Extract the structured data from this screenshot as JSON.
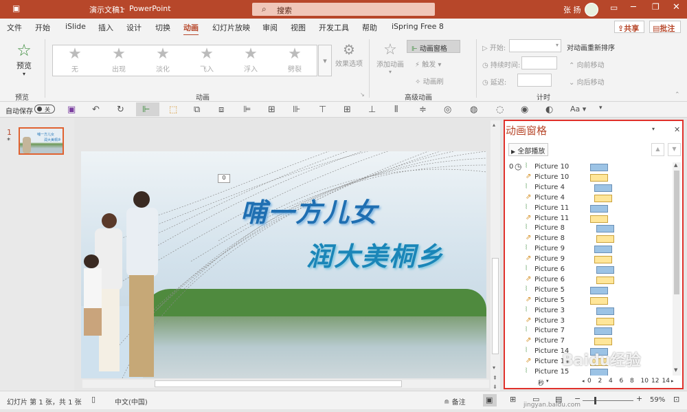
{
  "title": {
    "doc": "演示文稿1",
    "sep": "-",
    "app": "PowerPoint",
    "user": "张 扬"
  },
  "search": {
    "placeholder": "搜索"
  },
  "tabs": [
    "文件",
    "开始",
    "iSlide",
    "插入",
    "设计",
    "切换",
    "动画",
    "幻灯片放映",
    "审阅",
    "视图",
    "开发工具",
    "帮助",
    "iSpring Free 8"
  ],
  "active_tab": "动画",
  "share": {
    "share": "共享",
    "comment": "批注"
  },
  "ribbon": {
    "preview": "预览",
    "preview_group": "预览",
    "gallery": [
      "无",
      "出现",
      "淡化",
      "飞入",
      "浮入",
      "劈裂"
    ],
    "effect_options": "效果选项",
    "animation_group": "动画",
    "add_animation": "添加动画",
    "anim_pane": "动画窗格",
    "trigger": "触发",
    "anim_brush": "动画刷",
    "advanced_group": "高级动画",
    "start": "开始:",
    "duration": "持续时间:",
    "delay": "延迟:",
    "reorder": "对动画重新排序",
    "move_earlier": "向前移动",
    "move_later": "向后移动",
    "timing_group": "计时"
  },
  "qat": {
    "autosave": "自动保存",
    "toggle": "关"
  },
  "thumb": {
    "number": "1",
    "star": "*"
  },
  "slide": {
    "tag": "0",
    "line1": "哺一方儿女",
    "line2": "润大美桐乡"
  },
  "pane": {
    "title": "动画窗格",
    "play_all": "全部播放",
    "step": "0",
    "items": [
      {
        "label": "Picture 10",
        "kind": "b",
        "start": 0.0,
        "len": 0.26
      },
      {
        "label": "Picture 10",
        "kind": "y",
        "start": 0.0,
        "len": 0.26
      },
      {
        "label": "Picture 4",
        "kind": "b",
        "start": 0.06,
        "len": 0.26
      },
      {
        "label": "Picture 4",
        "kind": "y",
        "start": 0.06,
        "len": 0.26
      },
      {
        "label": "Picture 11",
        "kind": "b",
        "start": 0.0,
        "len": 0.26
      },
      {
        "label": "Picture 11",
        "kind": "y",
        "start": 0.0,
        "len": 0.26
      },
      {
        "label": "Picture 8",
        "kind": "b",
        "start": 0.09,
        "len": 0.26
      },
      {
        "label": "Picture 8",
        "kind": "y",
        "start": 0.09,
        "len": 0.26
      },
      {
        "label": "Picture 9",
        "kind": "b",
        "start": 0.06,
        "len": 0.26
      },
      {
        "label": "Picture 9",
        "kind": "y",
        "start": 0.06,
        "len": 0.26
      },
      {
        "label": "Picture 6",
        "kind": "b",
        "start": 0.09,
        "len": 0.26
      },
      {
        "label": "Picture 6",
        "kind": "y",
        "start": 0.09,
        "len": 0.26
      },
      {
        "label": "Picture 5",
        "kind": "b",
        "start": 0.0,
        "len": 0.26
      },
      {
        "label": "Picture 5",
        "kind": "y",
        "start": 0.0,
        "len": 0.26
      },
      {
        "label": "Picture 3",
        "kind": "b",
        "start": 0.09,
        "len": 0.26
      },
      {
        "label": "Picture 3",
        "kind": "y",
        "start": 0.09,
        "len": 0.26
      },
      {
        "label": "Picture 7",
        "kind": "b",
        "start": 0.06,
        "len": 0.26
      },
      {
        "label": "Picture 7",
        "kind": "y",
        "start": 0.06,
        "len": 0.26
      },
      {
        "label": "Picture 14",
        "kind": "b",
        "start": 0.0,
        "len": 0.26
      },
      {
        "label": "Picture 14",
        "kind": "y",
        "start": 0.0,
        "len": 0.26
      },
      {
        "label": "Picture 15",
        "kind": "b",
        "start": 0.0,
        "len": 0.26
      }
    ],
    "seconds": "秒",
    "ticks": [
      "0",
      "2",
      "4",
      "6",
      "8",
      "10",
      "12",
      "14"
    ]
  },
  "status": {
    "slide_info": "幻灯片 第 1 张，共 1 张",
    "lang": "中文(中国)",
    "notes": "备注",
    "zoom": "59%"
  },
  "watermark": {
    "text": "Baidu经验",
    "url": "jingyan.baidu.com"
  },
  "colors": {
    "accent": "#b7472a",
    "pane_border": "#e0302a",
    "bar_blue": "#9cc3e5",
    "bar_yellow": "#ffe699"
  }
}
